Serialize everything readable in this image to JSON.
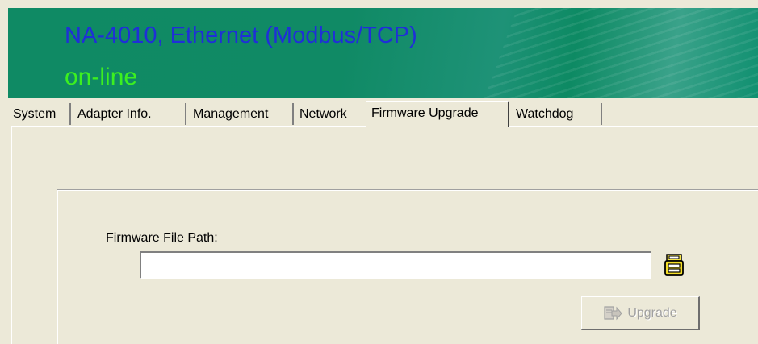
{
  "header": {
    "device_title": "NA-4010, Ethernet (Modbus/TCP)",
    "status": "on-line",
    "title_color": "#1f2fd8",
    "status_color": "#3cf020",
    "banner_color": "#0f8a64"
  },
  "tabs": [
    {
      "label": "System"
    },
    {
      "label": "Adapter Info."
    },
    {
      "label": "Management"
    },
    {
      "label": "Network"
    },
    {
      "label": "Firmware Upgrade",
      "active": true
    },
    {
      "label": "Watchdog"
    }
  ],
  "firmware": {
    "path_label": "Firmware File Path:",
    "path_value": "",
    "browse_icon": "open-file-icon",
    "upgrade_label": "Upgrade",
    "upgrade_icon": "upgrade-arrow-icon",
    "upgrade_enabled": false
  }
}
